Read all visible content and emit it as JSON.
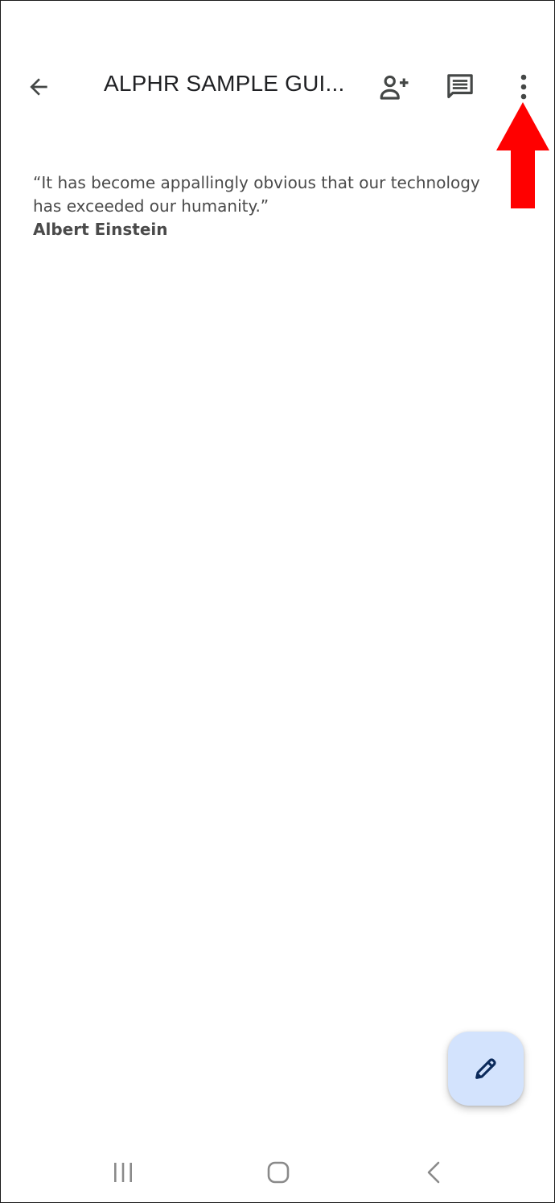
{
  "app_bar": {
    "title": "ALPHR SAMPLE GUI...",
    "back_icon": "arrow-back-icon",
    "share_icon": "person-add-icon",
    "comments_icon": "comment-icon",
    "more_icon": "more-vert-icon"
  },
  "document": {
    "quote_line_1": "“It has become appallingly obvious that our technology",
    "quote_line_2": "has exceeded our humanity.”",
    "author": "Albert Einstein"
  },
  "fab": {
    "icon": "edit-pencil-icon"
  },
  "annotation": {
    "arrow_color": "#ff0000",
    "icon": "red-arrow-annotation"
  },
  "system_nav": {
    "recents_icon": "recents-icon",
    "home_icon": "home-icon",
    "back_icon": "nav-back-icon"
  },
  "colors": {
    "icon": "#5f6368",
    "text": "#4a4a4a",
    "fab_bg": "#d3e3fd",
    "fab_icon": "#0b2a5b"
  }
}
